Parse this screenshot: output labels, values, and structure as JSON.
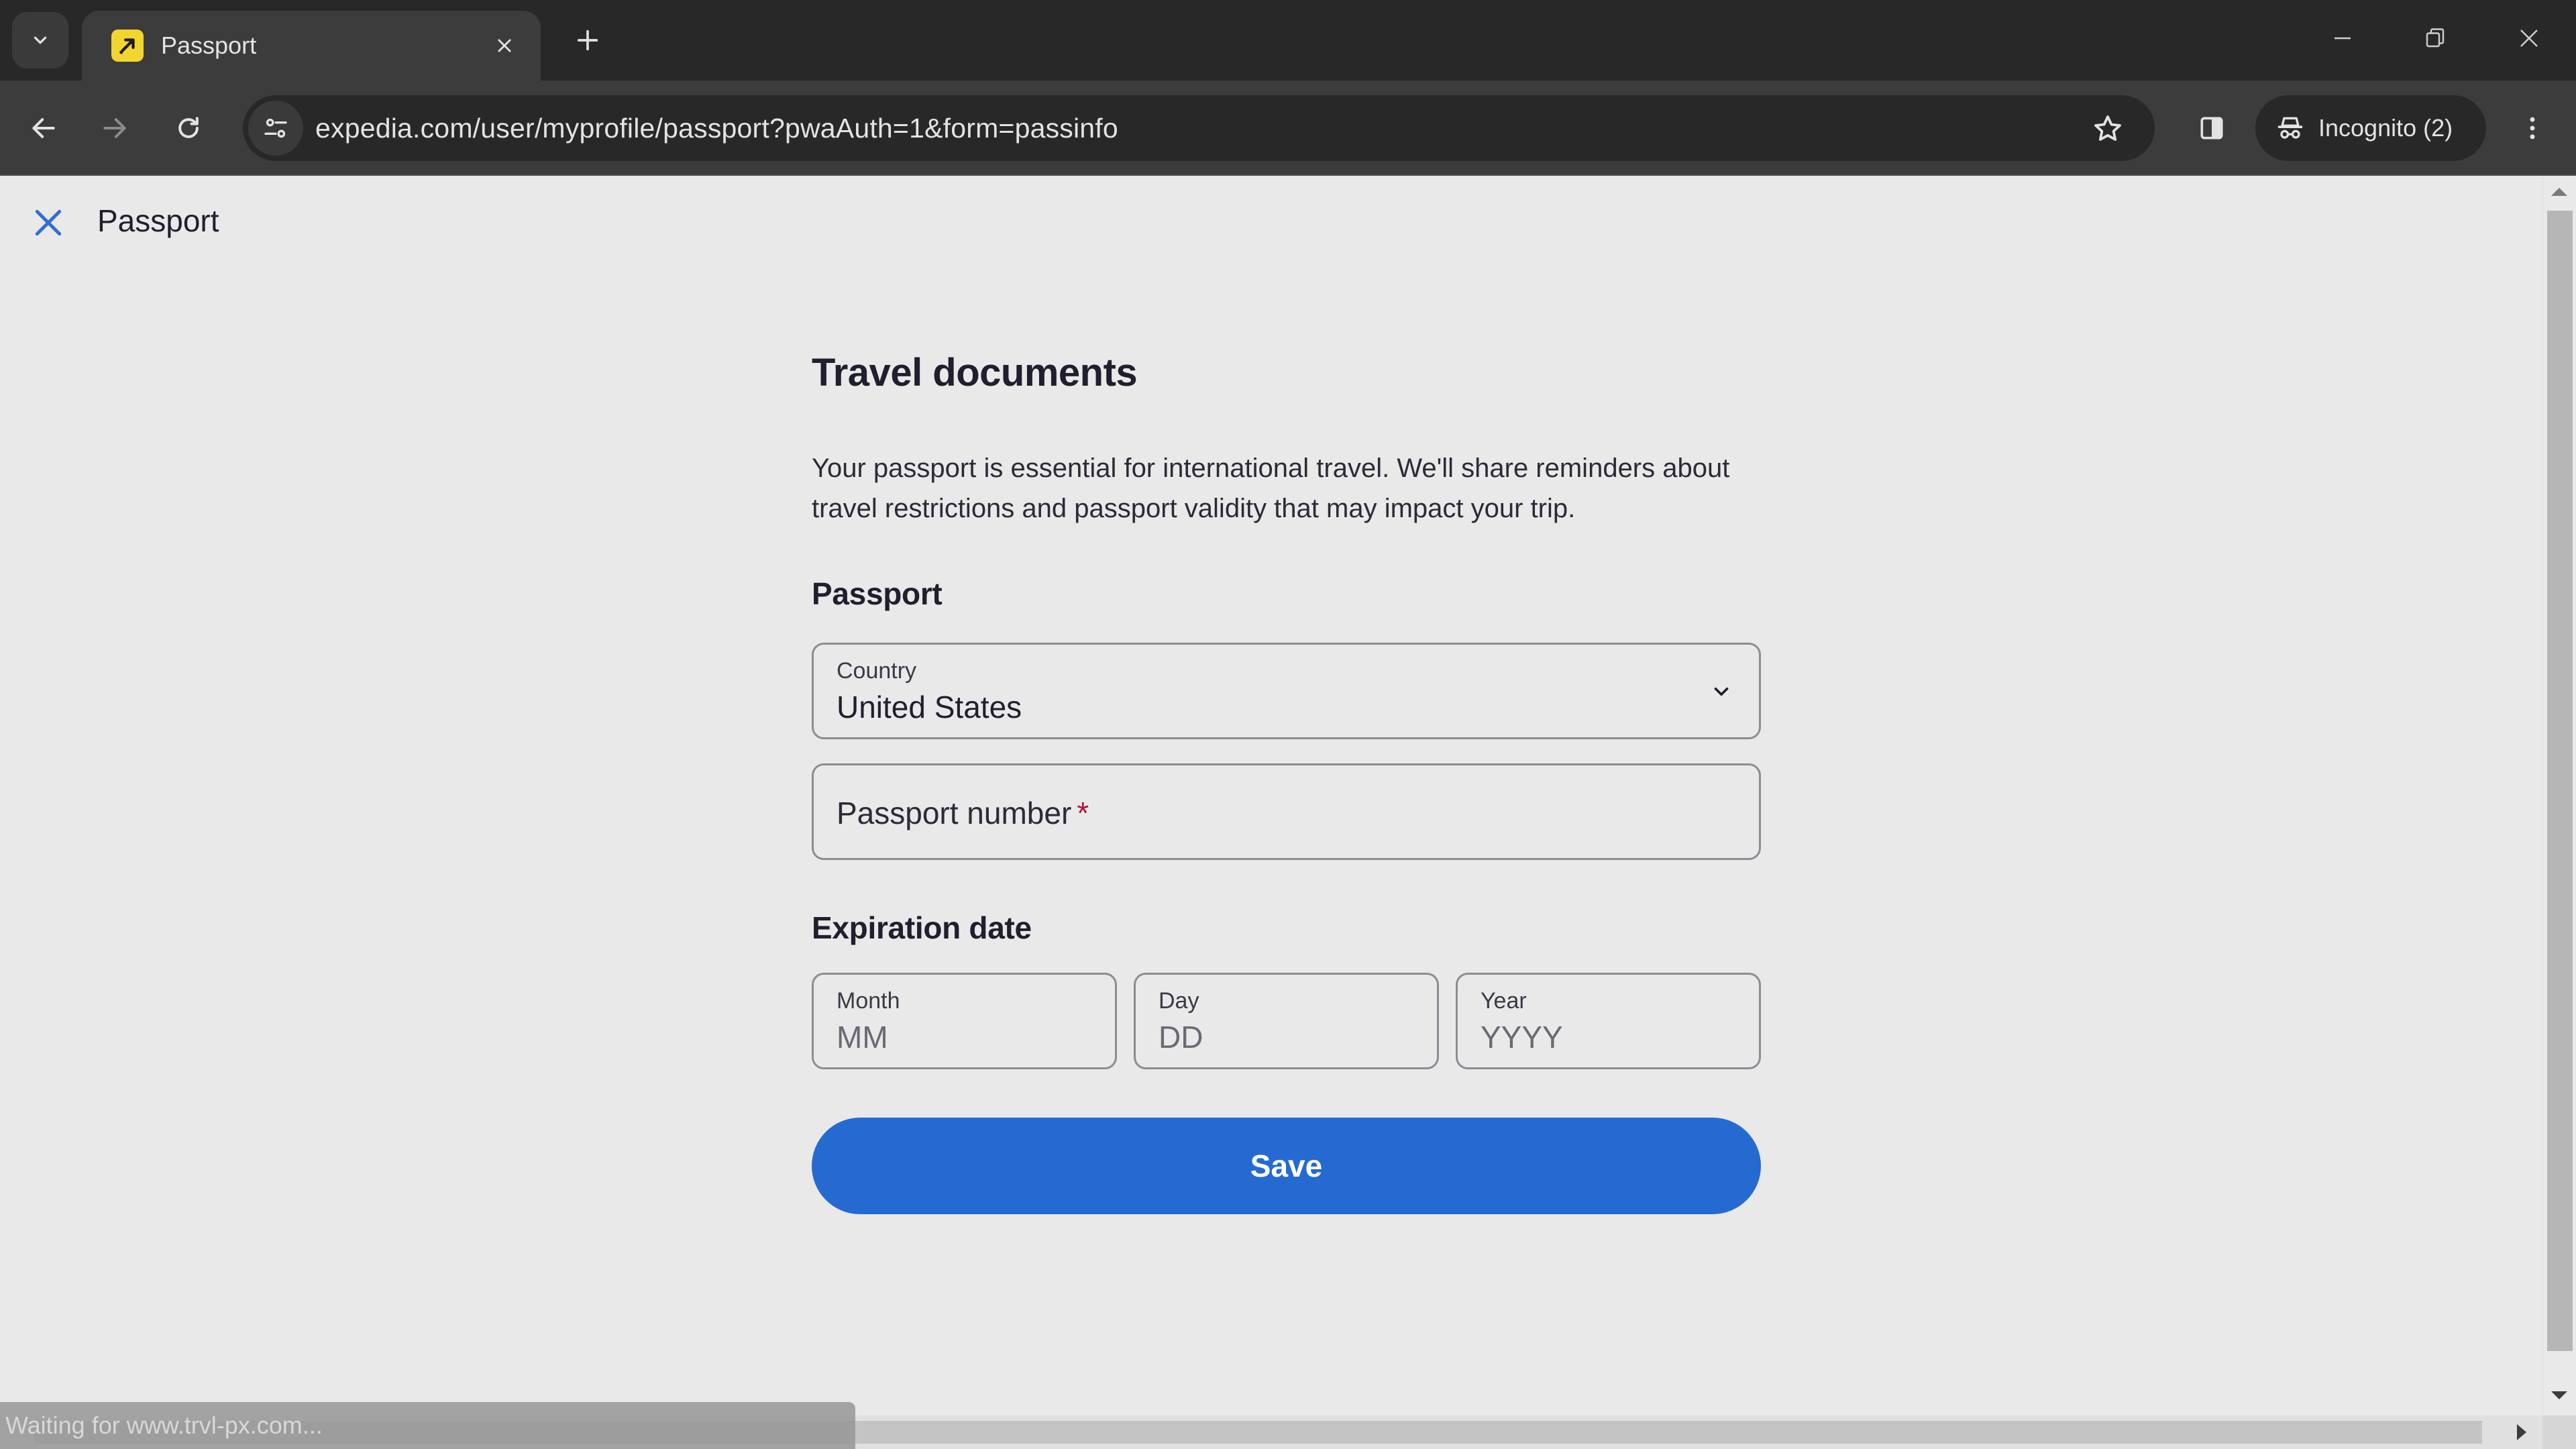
{
  "browser": {
    "tab": {
      "title": "Passport",
      "favicon": "expedia-logo-icon"
    },
    "url": "expedia.com/user/myprofile/passport?pwaAuth=1&form=passinfo",
    "incognito_label": "Incognito (2)",
    "status_text": "Waiting for www.trvl-px.com...",
    "icons": {
      "tab_search": "chevron-down-icon",
      "tab_close": "close-icon",
      "new_tab": "plus-icon",
      "back": "arrow-left-icon",
      "forward": "arrow-right-icon",
      "reload": "reload-icon",
      "site_info": "tune-icon",
      "bookmark": "star-icon",
      "side_panel": "side-panel-icon",
      "incognito": "incognito-icon",
      "menu": "kebab-menu-icon",
      "minimize": "minimize-icon",
      "restore": "restore-icon",
      "close_window": "close-icon"
    }
  },
  "page": {
    "header_title": "Passport",
    "heading": "Travel documents",
    "description": "Your passport is essential for international travel. We'll share reminders about travel restrictions and passport validity that may impact your trip.",
    "passport_section": {
      "title": "Passport",
      "country": {
        "label": "Country",
        "value": "United States"
      },
      "passport_number": {
        "label": "Passport number",
        "required_mark": "*",
        "value": ""
      }
    },
    "expiration_section": {
      "title": "Expiration date",
      "month": {
        "label": "Month",
        "placeholder": "MM"
      },
      "day": {
        "label": "Day",
        "placeholder": "DD"
      },
      "year": {
        "label": "Year",
        "placeholder": "YYYY"
      }
    },
    "save_label": "Save"
  },
  "colors": {
    "accent": "#256ad0",
    "required": "#b3123d",
    "page_bg": "#e9e9e9",
    "favicon": "#f3d52f"
  }
}
